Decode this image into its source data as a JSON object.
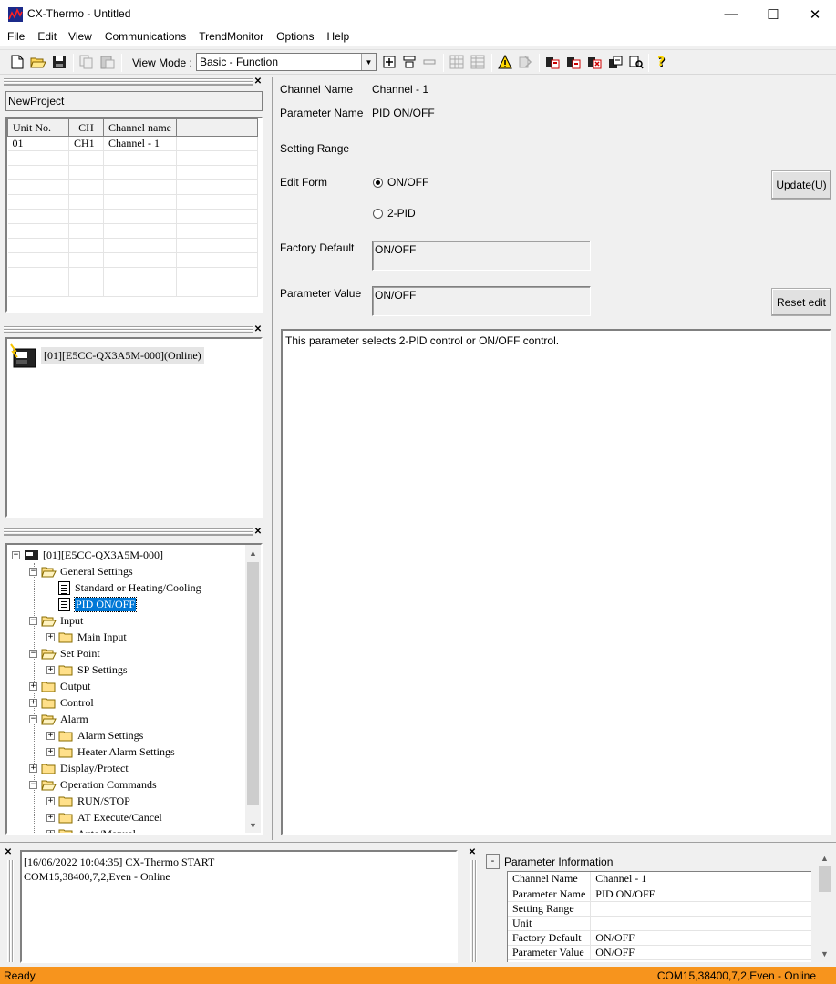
{
  "window": {
    "title": "CX-Thermo - Untitled",
    "minimize": "—",
    "maximize": "☐",
    "close": "✕"
  },
  "menu": [
    "File",
    "Edit",
    "View",
    "Communications",
    "TrendMonitor",
    "Options",
    "Help"
  ],
  "toolbar": {
    "view_mode_label": "View Mode :",
    "view_mode_value": "Basic - Function",
    "icons": [
      "new-icon",
      "open-icon",
      "save-icon",
      "copy-icon",
      "paste-icon",
      "add-icon",
      "insert-icon",
      "remove-icon",
      "grid-icon",
      "table-icon",
      "warning-icon",
      "compare-icon",
      "device-icon-1",
      "device-icon-2",
      "device-icon-3",
      "device-icon-4",
      "device-icon-5",
      "help-icon"
    ]
  },
  "project": {
    "name": "NewProject",
    "table_headers": [
      "Unit No.",
      "CH",
      "Channel name"
    ],
    "rows": [
      {
        "unit": "01",
        "ch": "CH1",
        "name": "Channel - 1"
      }
    ]
  },
  "device": {
    "label": "[01][E5CC-QX3A5M-000](Online)"
  },
  "tree": {
    "root": "[01][E5CC-QX3A5M-000]",
    "items": [
      {
        "label": "General Settings",
        "level": 1,
        "type": "folder",
        "expanded": true
      },
      {
        "label": "Standard or Heating/Cooling",
        "level": 2,
        "type": "doc"
      },
      {
        "label": "PID ON/OFF",
        "level": 2,
        "type": "doc",
        "selected": true
      },
      {
        "label": "Input",
        "level": 1,
        "type": "folder",
        "expanded": true
      },
      {
        "label": "Main Input",
        "level": 2,
        "type": "folder",
        "expanded": false
      },
      {
        "label": "Set Point",
        "level": 1,
        "type": "folder",
        "expanded": true
      },
      {
        "label": "SP Settings",
        "level": 2,
        "type": "folder",
        "expanded": false
      },
      {
        "label": "Output",
        "level": 1,
        "type": "folder",
        "expanded": false
      },
      {
        "label": "Control",
        "level": 1,
        "type": "folder",
        "expanded": false
      },
      {
        "label": "Alarm",
        "level": 1,
        "type": "folder",
        "expanded": true
      },
      {
        "label": "Alarm Settings",
        "level": 2,
        "type": "folder",
        "expanded": false
      },
      {
        "label": "Heater Alarm Settings",
        "level": 2,
        "type": "folder",
        "expanded": false
      },
      {
        "label": "Display/Protect",
        "level": 1,
        "type": "folder",
        "expanded": false
      },
      {
        "label": "Operation Commands",
        "level": 1,
        "type": "folder",
        "expanded": true
      },
      {
        "label": "RUN/STOP",
        "level": 2,
        "type": "folder",
        "expanded": false
      },
      {
        "label": "AT Execute/Cancel",
        "level": 2,
        "type": "folder",
        "expanded": false
      },
      {
        "label": "Auto/Manual",
        "level": 2,
        "type": "folder",
        "expanded": false
      }
    ]
  },
  "detail": {
    "channel_name_label": "Channel Name",
    "channel_name_value": "Channel - 1",
    "parameter_name_label": "Parameter Name",
    "parameter_name_value": "PID ON/OFF",
    "setting_range_label": "Setting Range",
    "edit_form_label": "Edit Form",
    "option_on_off": "ON/OFF",
    "option_2pid": "2-PID",
    "selected_option": "ON/OFF",
    "update_button": "Update(U)",
    "factory_default_label": "Factory Default",
    "factory_default_value": "ON/OFF",
    "parameter_value_label": "Parameter Value",
    "parameter_value_value": "ON/OFF",
    "reset_button": "Reset edit",
    "description": "This parameter selects 2-PID control or ON/OFF control."
  },
  "log": {
    "lines": [
      "[16/06/2022 10:04:35] CX-Thermo START",
      "COM15,38400,7,2,Even - Online"
    ]
  },
  "param_info": {
    "title": "Parameter Information",
    "collapse": "-",
    "rows": [
      {
        "key": "Channel Name",
        "value": "Channel - 1"
      },
      {
        "key": "Parameter Name",
        "value": "PID ON/OFF"
      },
      {
        "key": "Setting Range",
        "value": ""
      },
      {
        "key": "Unit",
        "value": ""
      },
      {
        "key": "Factory Default",
        "value": "ON/OFF"
      },
      {
        "key": "Parameter Value",
        "value": "ON/OFF"
      }
    ]
  },
  "status": {
    "left": "Ready",
    "right": "COM15,38400,7,2,Even - Online"
  },
  "colors": {
    "status_bar": "#f7941d",
    "selection": "#0078d7"
  }
}
